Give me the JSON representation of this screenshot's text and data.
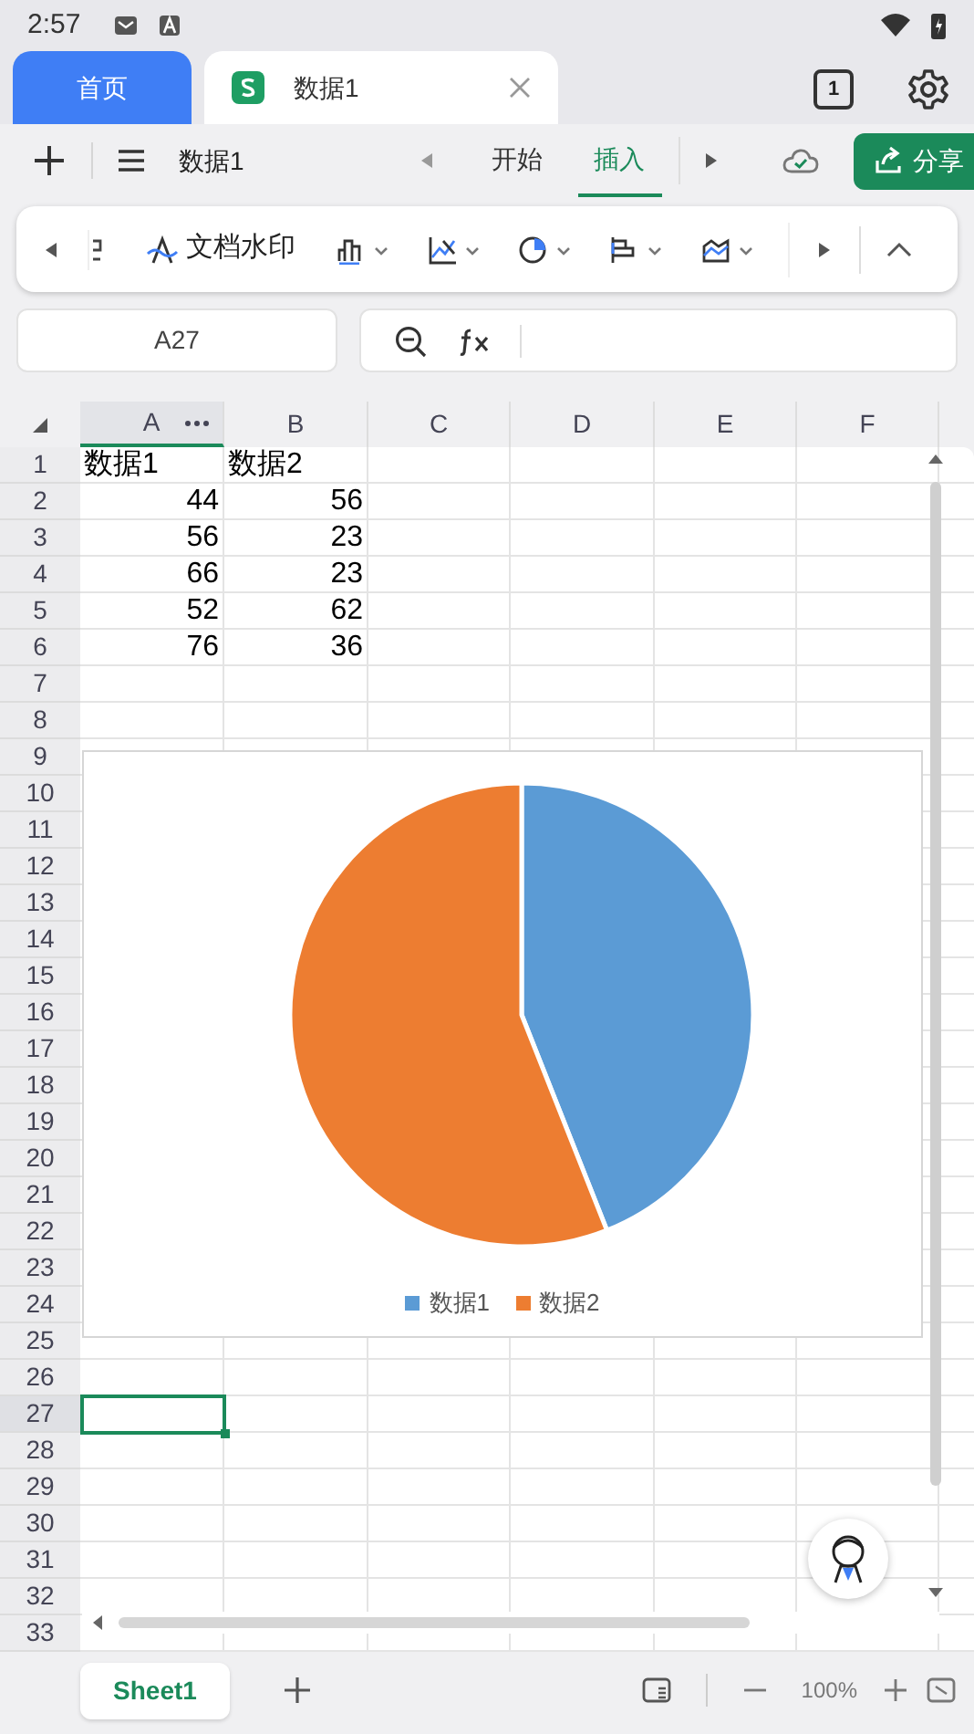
{
  "status_bar": {
    "time": "2:57"
  },
  "app_tabs": [
    {
      "label": "首页",
      "kind": "home",
      "selected": false
    },
    {
      "label": "数据1",
      "kind": "document",
      "selected": true
    }
  ],
  "tab_count": "1",
  "toolbar": {
    "document_title": "数据1",
    "tabs": [
      {
        "label": "开始",
        "selected": false
      },
      {
        "label": "插入",
        "selected": true
      }
    ],
    "share_label": "分享"
  },
  "ribbon": {
    "watermark_label": "文档水印"
  },
  "name_box": "A27",
  "sheet": {
    "columns": [
      {
        "label": "A",
        "selected": true
      },
      {
        "label": "B",
        "selected": false
      },
      {
        "label": "C",
        "selected": false
      },
      {
        "label": "D",
        "selected": false
      },
      {
        "label": "E",
        "selected": false
      },
      {
        "label": "F",
        "selected": false
      }
    ],
    "rows": [
      {
        "label": "1",
        "selected": false,
        "cells": [
          {
            "text": "数据1",
            "kind": "text"
          },
          {
            "text": "数据2",
            "kind": "text"
          }
        ]
      },
      {
        "label": "2",
        "selected": false,
        "cells": [
          {
            "text": "44",
            "kind": "number"
          },
          {
            "text": "56",
            "kind": "number"
          }
        ]
      },
      {
        "label": "3",
        "selected": false,
        "cells": [
          {
            "text": "56",
            "kind": "number"
          },
          {
            "text": "23",
            "kind": "number"
          }
        ]
      },
      {
        "label": "4",
        "selected": false,
        "cells": [
          {
            "text": "66",
            "kind": "number"
          },
          {
            "text": "23",
            "kind": "number"
          }
        ]
      },
      {
        "label": "5",
        "selected": false,
        "cells": [
          {
            "text": "52",
            "kind": "number"
          },
          {
            "text": "62",
            "kind": "number"
          }
        ]
      },
      {
        "label": "6",
        "selected": false,
        "cells": [
          {
            "text": "76",
            "kind": "number"
          },
          {
            "text": "36",
            "kind": "number"
          }
        ]
      },
      {
        "label": "7",
        "selected": false
      },
      {
        "label": "8",
        "selected": false
      },
      {
        "label": "9",
        "selected": false
      },
      {
        "label": "10",
        "selected": false
      },
      {
        "label": "11",
        "selected": false
      },
      {
        "label": "12",
        "selected": false
      },
      {
        "label": "13",
        "selected": false
      },
      {
        "label": "14",
        "selected": false
      },
      {
        "label": "15",
        "selected": false
      },
      {
        "label": "16",
        "selected": false
      },
      {
        "label": "17",
        "selected": false
      },
      {
        "label": "18",
        "selected": false
      },
      {
        "label": "19",
        "selected": false
      },
      {
        "label": "20",
        "selected": false
      },
      {
        "label": "21",
        "selected": false
      },
      {
        "label": "22",
        "selected": false
      },
      {
        "label": "23",
        "selected": false
      },
      {
        "label": "24",
        "selected": false
      },
      {
        "label": "25",
        "selected": false
      },
      {
        "label": "26",
        "selected": false
      },
      {
        "label": "27",
        "selected": true
      },
      {
        "label": "28",
        "selected": false
      },
      {
        "label": "29",
        "selected": false
      },
      {
        "label": "30",
        "selected": false
      },
      {
        "label": "31",
        "selected": false
      },
      {
        "label": "32",
        "selected": false
      },
      {
        "label": "33",
        "selected": false
      }
    ],
    "chart_data": {
      "type": "pie",
      "categories": [
        "数据1",
        "数据2"
      ],
      "values": [
        44,
        56
      ],
      "colors": [
        "#5b9bd5",
        "#ed7d31"
      ],
      "legend": "bottom"
    }
  },
  "sheet_tabs": [
    {
      "label": "Sheet1",
      "selected": true
    }
  ],
  "zoom": "100%"
}
